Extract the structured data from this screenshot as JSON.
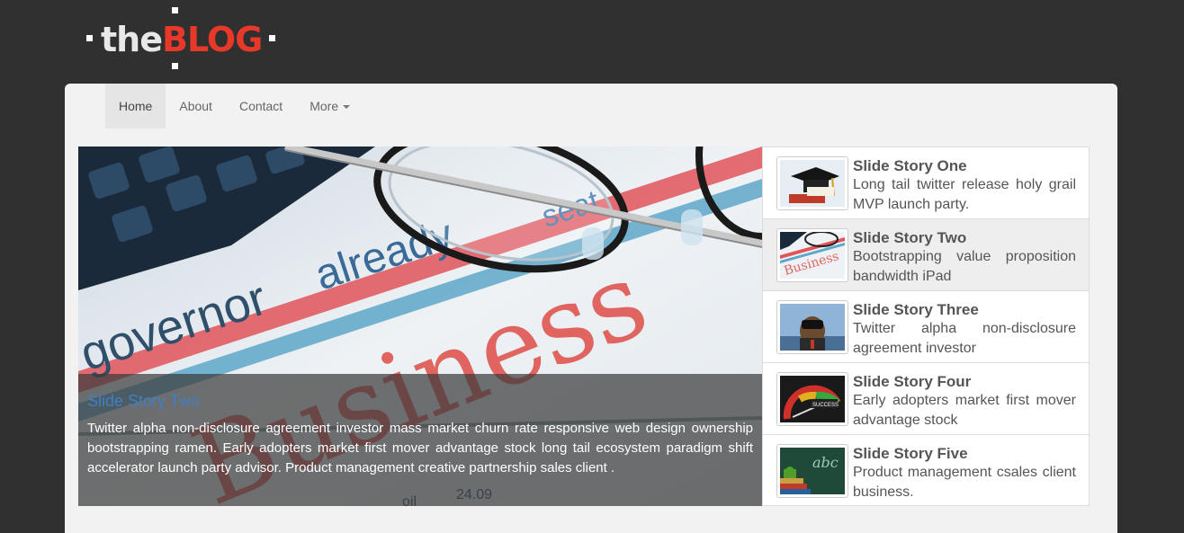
{
  "logo": {
    "the": "the",
    "blog": "BLOG"
  },
  "nav": {
    "items": [
      {
        "label": "Home"
      },
      {
        "label": "About"
      },
      {
        "label": "Contact"
      },
      {
        "label": "More"
      }
    ]
  },
  "hero": {
    "caption_title": "Slide Story Two",
    "caption_text": "Twitter alpha non-disclosure agreement investor mass market churn rate responsive web design ownership bootstrapping ramen. Early adopters market first mover advantage stock long tail ecosystem paradigm shift accelerator launch party advisor. Product management creative partnership sales client ."
  },
  "stories": [
    {
      "title": "Slide Story One",
      "text": "Long tail twitter release holy grail MVP launch party.",
      "icon": "graduation-cap-thumbnail"
    },
    {
      "title": "Slide Story Two",
      "text": "Bootstrapping value proposition bandwidth iPad",
      "icon": "business-newspaper-thumbnail"
    },
    {
      "title": "Slide Story Three",
      "text": "Twitter alpha non-disclosure agreement investor",
      "icon": "binoculars-man-thumbnail"
    },
    {
      "title": "Slide Story Four",
      "text": "Early adopters market first mover advantage stock",
      "icon": "success-gauge-thumbnail"
    },
    {
      "title": "Slide Story Five",
      "text": "Product management csales client business.",
      "icon": "chalkboard-abc-thumbnail"
    }
  ],
  "colors": {
    "background": "#303030",
    "brand_red": "#e8382a",
    "caption_title": "#3f7fc4"
  }
}
